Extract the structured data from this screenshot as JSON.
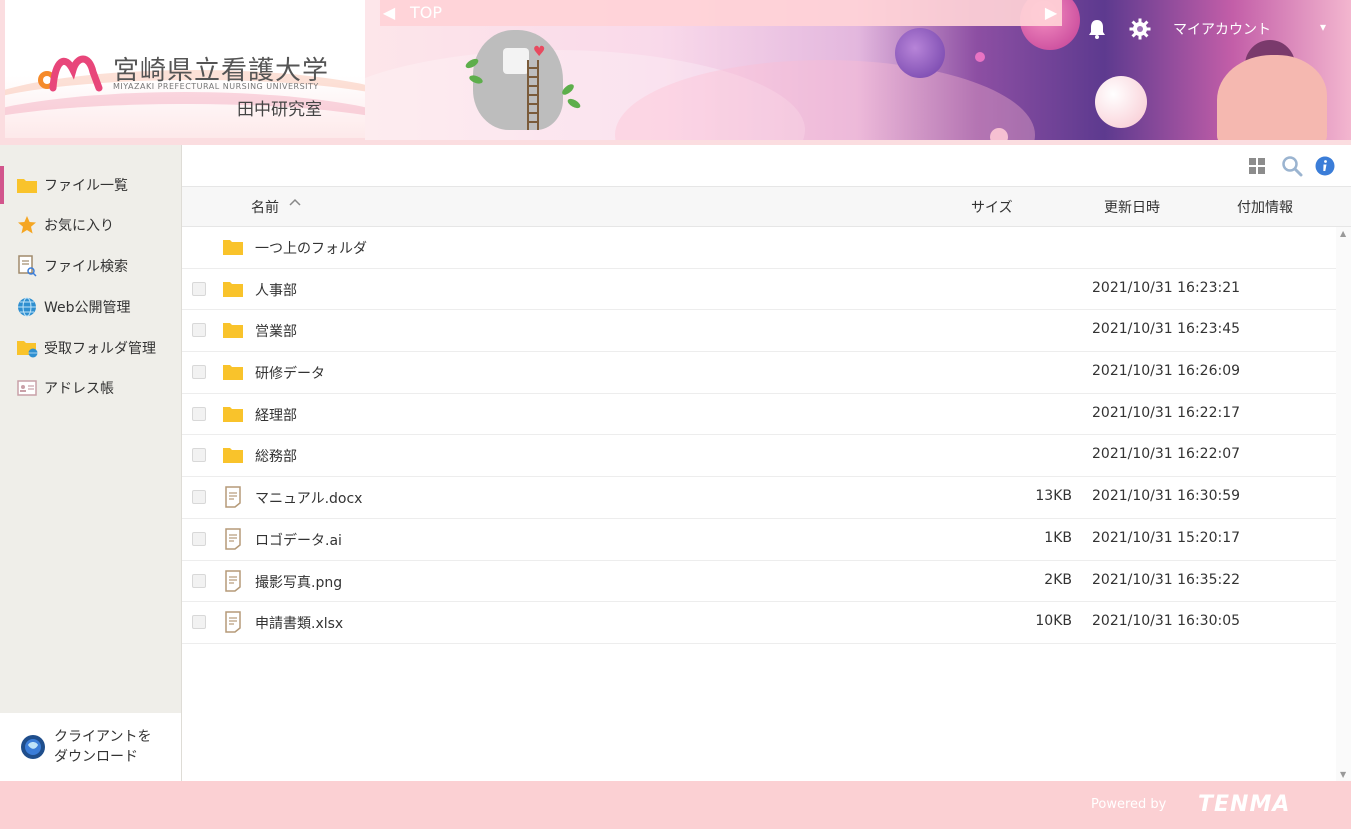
{
  "header": {
    "university_name": "宮崎県立看護大学",
    "university_name_en": "MIYAZAKI PREFECTURAL NURSING UNIVERSITY",
    "lab_name": "田中研究室",
    "nav_label": "TOP",
    "my_account": "マイアカウント"
  },
  "sidebar": {
    "items": [
      {
        "label": "ファイル一覧",
        "icon": "folder-icon"
      },
      {
        "label": "お気に入り",
        "icon": "star-icon"
      },
      {
        "label": "ファイル検索",
        "icon": "file-search-icon"
      },
      {
        "label": "Web公開管理",
        "icon": "globe-icon"
      },
      {
        "label": "受取フォルダ管理",
        "icon": "folder-globe-icon"
      },
      {
        "label": "アドレス帳",
        "icon": "address-card-icon"
      }
    ],
    "client_download_line1": "クライアントを",
    "client_download_line2": "ダウンロード"
  },
  "columns": {
    "name": "名前",
    "size": "サイズ",
    "updated": "更新日時",
    "extra": "付加情報"
  },
  "parent_folder": "一つ上のフォルダ",
  "files": [
    {
      "name": "人事部",
      "type": "folder",
      "size": "",
      "date": "2021/10/31 16:23:21"
    },
    {
      "name": "営業部",
      "type": "folder",
      "size": "",
      "date": "2021/10/31 16:23:45"
    },
    {
      "name": "研修データ",
      "type": "folder",
      "size": "",
      "date": "2021/10/31 16:26:09"
    },
    {
      "name": "経理部",
      "type": "folder",
      "size": "",
      "date": "2021/10/31 16:22:17"
    },
    {
      "name": "総務部",
      "type": "folder",
      "size": "",
      "date": "2021/10/31 16:22:07"
    },
    {
      "name": "マニュアル.docx",
      "type": "file",
      "size": "13KB",
      "date": "2021/10/31 16:30:59"
    },
    {
      "name": "ロゴデータ.ai",
      "type": "file",
      "size": "1KB",
      "date": "2021/10/31 15:20:17"
    },
    {
      "name": "撮影写真.png",
      "type": "file",
      "size": "2KB",
      "date": "2021/10/31 16:35:22"
    },
    {
      "name": "申請書類.xlsx",
      "type": "file",
      "size": "10KB",
      "date": "2021/10/31 16:30:05"
    }
  ],
  "footer": {
    "powered_by": "Powered by",
    "brand": "TENMA"
  },
  "colors": {
    "accent_pink": "#d2558c",
    "folder_yellow": "#f9c32b",
    "footer_pink": "#fbd0d3",
    "sidebar_bg": "#efeee9",
    "info_blue": "#3b7dd8"
  }
}
